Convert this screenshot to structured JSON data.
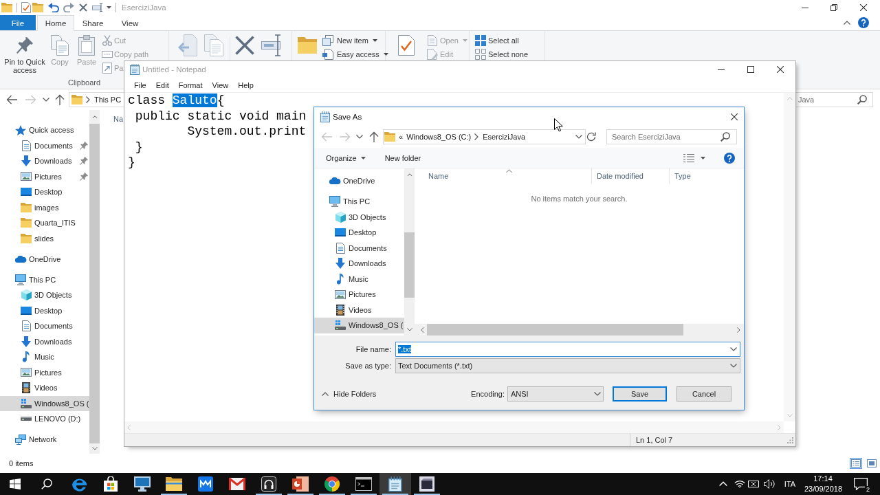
{
  "explorer": {
    "title": "EserciziJava",
    "active": false,
    "ribbon_tabs": [
      {
        "label": "File",
        "kind": "backstage",
        "selected": false
      },
      {
        "label": "Home",
        "kind": "tab",
        "selected": true
      },
      {
        "label": "Share",
        "kind": "tab",
        "selected": false
      },
      {
        "label": "View",
        "kind": "tab",
        "selected": false
      }
    ],
    "ribbon": {
      "clipboard": {
        "label": "Clipboard",
        "commands": [
          {
            "label": "Pin to Quick access",
            "kind": "large",
            "disabled": false
          },
          {
            "label": "Copy",
            "kind": "large",
            "disabled": true
          },
          {
            "label": "Paste",
            "kind": "large",
            "disabled": true
          },
          {
            "label": "Cut",
            "kind": "small",
            "disabled": true
          },
          {
            "label": "Copy path",
            "kind": "small",
            "disabled": true
          },
          {
            "label": "Pa",
            "kind": "small",
            "disabled": true
          }
        ]
      },
      "new": {
        "commands": [
          {
            "label": "New item",
            "kind": "dropdown",
            "disabled": false
          },
          {
            "label": "Easy access",
            "kind": "dropdown",
            "disabled": false
          }
        ]
      },
      "open": {
        "commands": [
          {
            "label": "Open",
            "kind": "dropdown",
            "disabled": true
          },
          {
            "label": "Edit",
            "kind": "small",
            "disabled": true
          }
        ]
      },
      "select": {
        "commands": [
          {
            "label": "Select all",
            "kind": "small",
            "disabled": false
          },
          {
            "label": "Select none",
            "kind": "small",
            "disabled": false
          }
        ]
      }
    },
    "nav_buttons": [
      {
        "kind": "back",
        "disabled": false
      },
      {
        "kind": "forward",
        "disabled": true
      },
      {
        "kind": "recent",
        "disabled": false
      },
      {
        "kind": "up",
        "disabled": false
      }
    ],
    "address": [
      "This PC"
    ],
    "search": {
      "placeholder": "Java"
    },
    "nav_pane": [
      {
        "label": "Quick access",
        "kind": "star",
        "selected": false,
        "children": [
          {
            "label": "Documents",
            "kind": "document",
            "selected": false,
            "pinned": true
          },
          {
            "label": "Downloads",
            "kind": "download",
            "selected": false,
            "pinned": true
          },
          {
            "label": "Pictures",
            "kind": "picture",
            "selected": false,
            "pinned": true
          },
          {
            "label": "Desktop",
            "kind": "desktop",
            "selected": false,
            "pinned": false
          },
          {
            "label": "images",
            "kind": "folder",
            "selected": false,
            "pinned": false
          },
          {
            "label": "Quarta_ITIS",
            "kind": "folder",
            "selected": false,
            "pinned": false
          },
          {
            "label": "slides",
            "kind": "folder",
            "selected": false,
            "pinned": false
          }
        ]
      },
      {
        "label": "OneDrive",
        "kind": "cloud",
        "selected": false
      },
      {
        "label": "This PC",
        "kind": "computer",
        "selected": false,
        "children": [
          {
            "label": "3D Objects",
            "kind": "cube",
            "selected": false
          },
          {
            "label": "Desktop",
            "kind": "desktop",
            "selected": false
          },
          {
            "label": "Documents",
            "kind": "document",
            "selected": false
          },
          {
            "label": "Downloads",
            "kind": "download",
            "selected": false
          },
          {
            "label": "Music",
            "kind": "music",
            "selected": false
          },
          {
            "label": "Pictures",
            "kind": "picture",
            "selected": false
          },
          {
            "label": "Videos",
            "kind": "film",
            "selected": false
          },
          {
            "label": "Windows8_OS (",
            "kind": "systemdrive",
            "selected": true
          },
          {
            "label": "LENOVO (D:)",
            "kind": "drive",
            "selected": false
          }
        ]
      },
      {
        "label": "Network",
        "kind": "network",
        "selected": false
      }
    ],
    "columns": [
      {
        "label": "Na"
      }
    ],
    "status_bar": {
      "item_count": "0 items",
      "views": [
        {
          "kind": "details",
          "selected": true
        },
        {
          "kind": "tiles",
          "selected": false
        }
      ]
    }
  },
  "notepad": {
    "title": "Untitled - Notepad",
    "active": false,
    "menu": [
      "File",
      "Edit",
      "Format",
      "View",
      "Help"
    ],
    "lines": [
      {
        "segments": [
          {
            "text": "class ",
            "selected": false
          },
          {
            "text": "Saluto",
            "selected": true
          },
          {
            "text": "{",
            "selected": false
          }
        ]
      },
      {
        "segments": [
          {
            "text": " public static void main",
            "selected": false
          }
        ]
      },
      {
        "segments": [
          {
            "text": "        System.out.print",
            "selected": false
          }
        ]
      },
      {
        "segments": [
          {
            "text": " }",
            "selected": false
          }
        ]
      },
      {
        "segments": [
          {
            "text": "}",
            "selected": false
          }
        ]
      }
    ],
    "status": "Ln 1, Col 7"
  },
  "save_as": {
    "title": "Save As",
    "active": true,
    "nav_buttons": [
      {
        "kind": "back",
        "disabled": true
      },
      {
        "kind": "forward",
        "disabled": true
      },
      {
        "kind": "recent",
        "disabled": false
      },
      {
        "kind": "up",
        "disabled": false
      }
    ],
    "address": {
      "overflow": "«",
      "parts": [
        "Windows8_OS (C:)",
        "EserciziJava"
      ]
    },
    "search": {
      "placeholder": "Search EserciziJava"
    },
    "toolbar": {
      "organize": "Organize",
      "new_folder": "New folder"
    },
    "tree": [
      {
        "label": "OneDrive",
        "kind": "cloud",
        "selected": false
      },
      {
        "label": "This PC",
        "kind": "computer",
        "selected": false,
        "children": [
          {
            "label": "3D Objects",
            "kind": "cube",
            "selected": false
          },
          {
            "label": "Desktop",
            "kind": "desktop",
            "selected": false
          },
          {
            "label": "Documents",
            "kind": "document",
            "selected": false
          },
          {
            "label": "Downloads",
            "kind": "download",
            "selected": false
          },
          {
            "label": "Music",
            "kind": "music",
            "selected": false
          },
          {
            "label": "Pictures",
            "kind": "picture",
            "selected": false
          },
          {
            "label": "Videos",
            "kind": "film",
            "selected": false
          },
          {
            "label": "Windows8_OS (",
            "kind": "systemdrive",
            "selected": true
          }
        ]
      }
    ],
    "columns": [
      {
        "label": "Name",
        "sorted": true
      },
      {
        "label": "Date modified",
        "sorted": false
      },
      {
        "label": "Type",
        "sorted": false
      }
    ],
    "empty_message": "No items match your search.",
    "file_name": {
      "label": "File name:",
      "value": "*.txt",
      "text_selected": true
    },
    "save_as_type": {
      "label": "Save as type:",
      "value": "Text Documents (*.txt)"
    },
    "hide_folders": "Hide Folders",
    "encoding": {
      "label": "Encoding:",
      "value": "ANSI"
    },
    "buttons": [
      {
        "label": "Save",
        "default": true
      },
      {
        "label": "Cancel",
        "default": false
      }
    ]
  },
  "taskbar": {
    "apps": [
      {
        "kind": "browser",
        "running": false,
        "selected": false
      },
      {
        "kind": "store",
        "running": false,
        "selected": false
      },
      {
        "kind": "monitor",
        "running": false,
        "selected": false
      },
      {
        "kind": "folder",
        "running": true,
        "selected": false
      },
      {
        "kind": "mtile",
        "running": false,
        "selected": false
      },
      {
        "kind": "mail",
        "running": false,
        "selected": false
      },
      {
        "kind": "headset",
        "running": true,
        "selected": false
      },
      {
        "kind": "slides",
        "running": true,
        "selected": false
      },
      {
        "kind": "chrome",
        "running": true,
        "selected": false
      },
      {
        "kind": "terminal",
        "running": true,
        "selected": false
      },
      {
        "kind": "notepad",
        "running": true,
        "selected": true
      },
      {
        "kind": "media",
        "running": true,
        "selected": false
      }
    ],
    "language": "ITA",
    "time": "17:14",
    "date": "23/09/2018",
    "notifications": "2"
  }
}
